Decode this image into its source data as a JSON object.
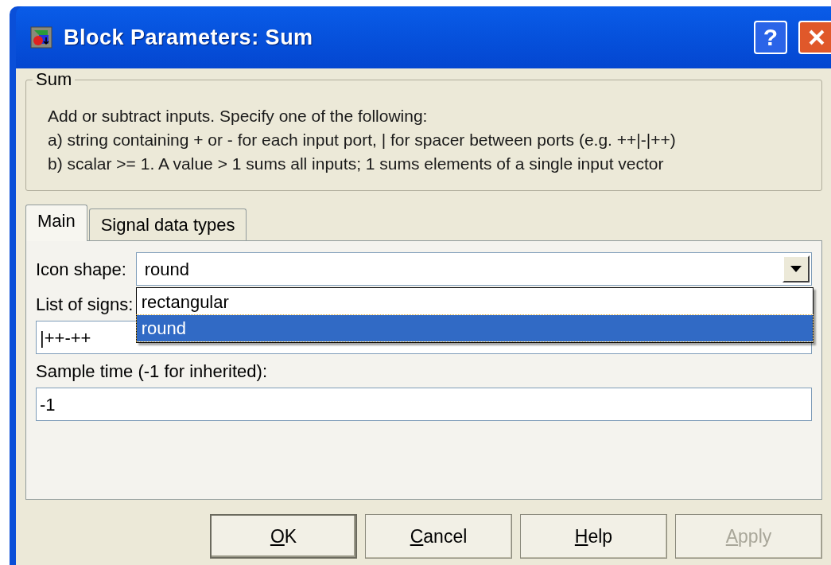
{
  "window": {
    "title": "Block Parameters: Sum",
    "help_glyph": "?"
  },
  "group": {
    "title": "Sum",
    "description": [
      "Add or subtract inputs.  Specify one of the following:",
      "a) string containing + or - for each input port, | for spacer between ports (e.g. ++|-|++)",
      "b) scalar >= 1. A value > 1 sums all inputs; 1 sums elements of a single input vector"
    ]
  },
  "tabs": [
    {
      "label": "Main",
      "selected": true
    },
    {
      "label": "Signal data types",
      "selected": false
    }
  ],
  "parameters": [
    {
      "kind": "dropdown",
      "label": "Icon shape:",
      "value": "round",
      "expanded": true,
      "options": [
        {
          "label": "rectangular",
          "selected": false
        },
        {
          "label": "round",
          "selected": true
        }
      ]
    },
    {
      "kind": "text",
      "label": "List of signs:",
      "value": "|++-++"
    },
    {
      "kind": "text",
      "label": "Sample time (-1 for inherited):",
      "value": "-1"
    }
  ],
  "buttons": [
    {
      "label": "OK",
      "default": true,
      "disabled": false,
      "access_key": true
    },
    {
      "label": "Cancel",
      "default": false,
      "disabled": false,
      "access_key": true
    },
    {
      "label": "Help",
      "default": false,
      "disabled": false,
      "access_key": true
    },
    {
      "label": "Apply",
      "default": false,
      "disabled": true,
      "access_key": true
    }
  ]
}
